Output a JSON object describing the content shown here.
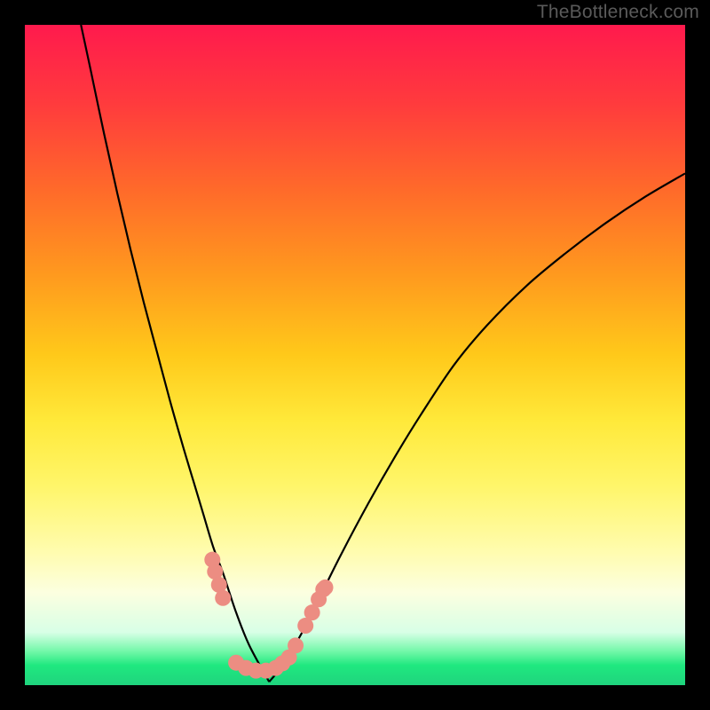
{
  "watermark": "TheBottleneck.com",
  "colors": {
    "frame": "#000000",
    "curve_stroke": "#000000",
    "marker_fill": "#ec8d82",
    "gradient_stops": [
      "#ff1a4d",
      "#ff3b3d",
      "#ff6a2a",
      "#ff9a1e",
      "#ffc91a",
      "#ffe93a",
      "#fff66b",
      "#fffcb0",
      "#fcffe0",
      "#d8ffe6",
      "#6ef7a6",
      "#1fe87f",
      "#1fd47e"
    ]
  },
  "chart_data": {
    "type": "line",
    "title": "",
    "xlabel": "",
    "ylabel": "",
    "xlim": [
      0,
      100
    ],
    "ylim": [
      0,
      100
    ],
    "grid": false,
    "series": [
      {
        "name": "left-branch",
        "x": [
          8.5,
          10,
          12,
          14,
          16,
          18,
          20,
          22,
          24,
          25.5,
          27,
          28.5,
          30,
          32,
          34,
          37
        ],
        "y": [
          100,
          93,
          83.5,
          74.5,
          66,
          58,
          50.5,
          43,
          36,
          31,
          26,
          21,
          17,
          11,
          6,
          0.5
        ]
      },
      {
        "name": "right-branch",
        "x": [
          37,
          39,
          42,
          45,
          48,
          52,
          56,
          60,
          65,
          70,
          76,
          82,
          88,
          94,
          100
        ],
        "y": [
          0.5,
          3,
          8,
          14,
          20,
          27.5,
          34.5,
          41,
          48.5,
          54.5,
          60.5,
          65.5,
          70,
          74,
          77.5
        ]
      }
    ],
    "markers": [
      {
        "name": "left-cluster-top",
        "x": 28.4,
        "y": 19.0
      },
      {
        "name": "left-cluster-mid-a",
        "x": 28.8,
        "y": 17.2
      },
      {
        "name": "left-cluster-mid-b",
        "x": 29.4,
        "y": 15.2
      },
      {
        "name": "left-cluster-low",
        "x": 30.0,
        "y": 13.2
      },
      {
        "name": "trough-a",
        "x": 32.0,
        "y": 3.4
      },
      {
        "name": "trough-b",
        "x": 33.5,
        "y": 2.6
      },
      {
        "name": "trough-c",
        "x": 35.0,
        "y": 2.2
      },
      {
        "name": "trough-d",
        "x": 36.5,
        "y": 2.2
      },
      {
        "name": "trough-e",
        "x": 38.0,
        "y": 2.6
      },
      {
        "name": "trough-f",
        "x": 39.0,
        "y": 3.3
      },
      {
        "name": "trough-g",
        "x": 40.0,
        "y": 4.2
      },
      {
        "name": "right-cluster-low",
        "x": 41.0,
        "y": 6.0
      },
      {
        "name": "right-cluster-mid-a",
        "x": 42.5,
        "y": 9.0
      },
      {
        "name": "right-cluster-mid-b",
        "x": 43.5,
        "y": 11.0
      },
      {
        "name": "right-cluster-top-a",
        "x": 44.5,
        "y": 13.0
      },
      {
        "name": "right-cluster-top-b",
        "x": 45.2,
        "y": 14.5
      },
      {
        "name": "right-cluster-top-c",
        "x": 45.5,
        "y": 14.8
      }
    ]
  }
}
